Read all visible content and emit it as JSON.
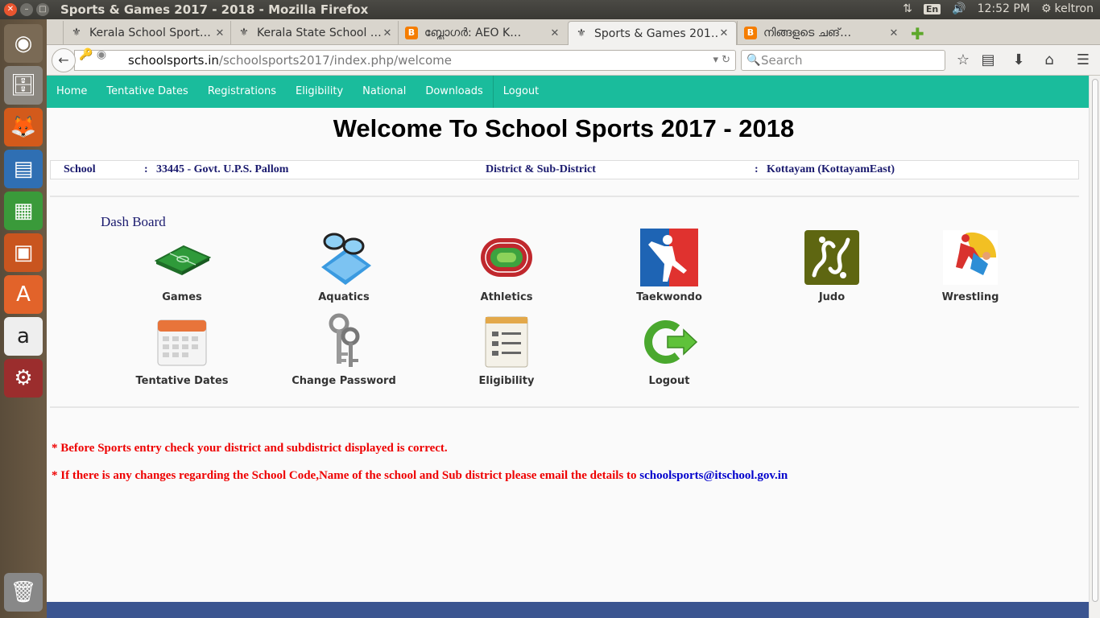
{
  "window": {
    "title": "Sports & Games 2017 - 2018 - Mozilla Firefox",
    "clock": "12:52 PM",
    "user": "keltron",
    "lang": "En"
  },
  "tabs": [
    {
      "label": "Kerala School Sport…",
      "icon": "site-icon"
    },
    {
      "label": "Kerala State School …",
      "icon": "site-icon"
    },
    {
      "label": "ബ്ലോഗർ: AEO K…",
      "icon": "blogger-icon"
    },
    {
      "label": "Sports & Games 201…",
      "icon": "site-icon",
      "active": true
    },
    {
      "label": "നിങ്ങളുടെ ചങ്…",
      "icon": "blogger-icon"
    }
  ],
  "urlbar": {
    "host": "schoolsports.in",
    "path": "/schoolsports2017/index.php/welcome"
  },
  "search": {
    "placeholder": "Search"
  },
  "site_nav": [
    "Home",
    "Tentative Dates",
    "Registrations",
    "Eligibility",
    "National",
    "Downloads",
    "Logout"
  ],
  "welcome": "Welcome To School Sports 2017 - 2018",
  "info": {
    "school_label": "School",
    "colon": ":",
    "school_value": "33445 - Govt. U.P.S. Pallom",
    "district_label": "District & Sub-District",
    "district_value": "Kottayam (KottayamEast)"
  },
  "dashboard": {
    "title": "Dash Board",
    "items": [
      "Games",
      "Aquatics",
      "Athletics",
      "Taekwondo",
      "Judo",
      "Wrestling",
      "Tentative Dates",
      "Change Password",
      "Eligibility",
      "Logout"
    ]
  },
  "notes": {
    "note1": "* Before Sports entry check your district and subdistrict displayed is correct.",
    "note2": "* If there is any changes regarding the School Code,Name of the school and Sub district please email the details to ",
    "email": "schoolsports@itschool.gov.in"
  },
  "colors": {
    "nav_bg": "#1abc9c",
    "info_text": "#1a1a6e",
    "note_text": "#ee0000",
    "footer": "#3b5590"
  }
}
